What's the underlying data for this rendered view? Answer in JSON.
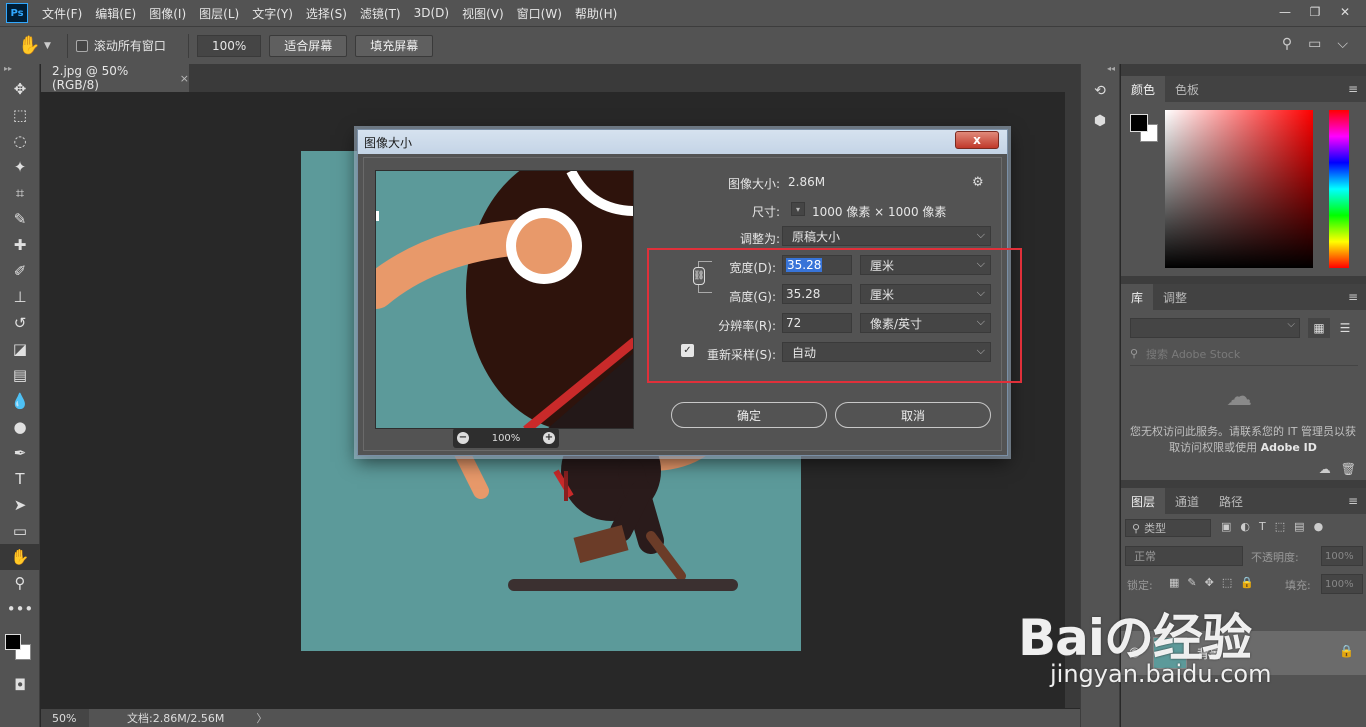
{
  "menu": {
    "logo": "Ps",
    "items": [
      "文件(F)",
      "编辑(E)",
      "图像(I)",
      "图层(L)",
      "文字(Y)",
      "选择(S)",
      "滤镜(T)",
      "3D(D)",
      "视图(V)",
      "窗口(W)",
      "帮助(H)"
    ]
  },
  "options": {
    "scroll_all": "滚动所有窗口",
    "zoom": "100%",
    "fit_screen": "适合屏幕",
    "fill_screen": "填充屏幕"
  },
  "document": {
    "tab_title": "2.jpg @ 50%(RGB/8)",
    "tab_close": "×",
    "status_zoom": "50%",
    "status_doc": "文档:2.86M/2.56M",
    "status_arrow": "〉"
  },
  "dialog": {
    "title": "图像大小",
    "close": "x",
    "image_size_label": "图像大小:",
    "image_size_value": "2.86M",
    "dimensions_label": "尺寸:",
    "dimensions_value": "1000 像素 × 1000 像素",
    "fit_to_label": "调整为:",
    "fit_to_value": "原稿大小",
    "width_label": "宽度(D):",
    "width_value": "35.28",
    "width_unit": "厘米",
    "height_label": "高度(G):",
    "height_value": "35.28",
    "height_unit": "厘米",
    "resolution_label": "分辨率(R):",
    "resolution_value": "72",
    "resolution_unit": "像素/英寸",
    "resample_label": "重新采样(S):",
    "resample_checked": true,
    "resample_value": "自动",
    "preview_zoom": "100%",
    "ok": "确定",
    "cancel": "取消"
  },
  "panels": {
    "color_tabs": [
      "颜色",
      "色板"
    ],
    "library_tabs": [
      "库",
      "调整"
    ],
    "library_search_placeholder": "搜索 Adobe Stock",
    "library_message": "您无权访问此服务。请联系您的 IT 管理员以获取访问权限或使用",
    "library_message_bold": "Adobe ID",
    "layers_tabs": [
      "图层",
      "通道",
      "路径"
    ],
    "layers_kind": "类型",
    "blend_mode": "正常",
    "opacity_label": "不透明度:",
    "opacity_value": "100%",
    "lock_label": "锁定:",
    "fill_label": "填充:",
    "fill_value": "100%",
    "layer_name": "背景"
  },
  "watermark": {
    "big": "Baiの经验",
    "small": "jingyan.baidu.com"
  },
  "colors": {
    "accent_selection": "#3874d8",
    "highlight_box": "#e0303a",
    "canvas_bg": "#5c9a9a"
  }
}
